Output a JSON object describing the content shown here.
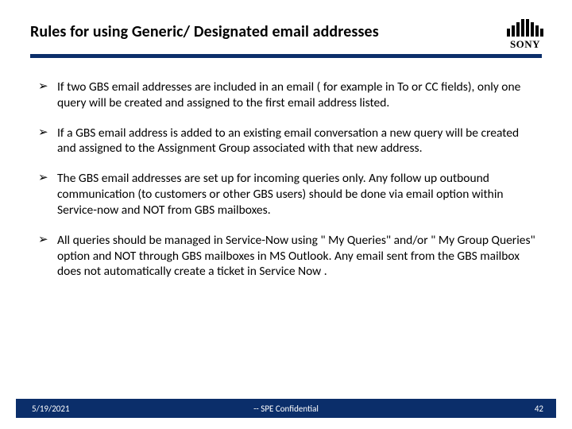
{
  "header": {
    "title": "Rules for using  Generic/ Designated email addresses",
    "logo_text": "SONY"
  },
  "bullets": [
    "If  two GBS email addresses are included in an email ( for example in To or CC fields), only one query will be created and assigned to the first email address listed.",
    "If  a GBS email address is added to an existing email conversation a new query will be created and assigned to the Assignment Group associated with that new address.",
    "The GBS email addresses are set up for incoming queries only. Any follow up outbound communication (to customers or other GBS users) should be done via email option within Service-now and NOT from GBS mailboxes.",
    "All queries should be managed in Service-Now using \" My Queries\" and/or \" My Group Queries\" option and NOT  through GBS mailboxes in MS Outlook.  Any email sent from the GBS mailbox does not automatically create a ticket in Service Now ."
  ],
  "footer": {
    "date": "5/19/2021",
    "center": "-- SPE Confidential",
    "page": "42"
  }
}
